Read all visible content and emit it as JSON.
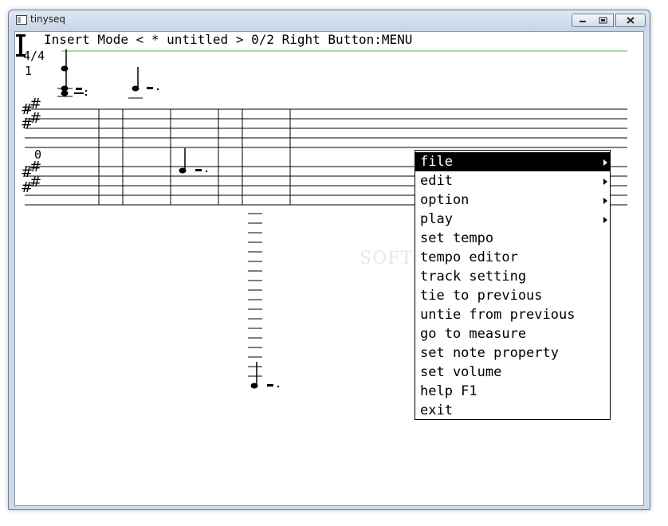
{
  "window": {
    "title": "tinyseq"
  },
  "status": {
    "text": "Insert Mode < * untitled > 0/2 Right Button:MENU"
  },
  "score": {
    "time_signature": "4/4",
    "measure_numbers": [
      "1",
      "0"
    ]
  },
  "menu": {
    "items": [
      {
        "label": "file",
        "submenu": true,
        "selected": true
      },
      {
        "label": "edit",
        "submenu": true,
        "selected": false
      },
      {
        "label": "option",
        "submenu": true,
        "selected": false
      },
      {
        "label": "play",
        "submenu": true,
        "selected": false
      },
      {
        "label": "set tempo",
        "submenu": false,
        "selected": false
      },
      {
        "label": "tempo editor",
        "submenu": false,
        "selected": false
      },
      {
        "label": "track setting",
        "submenu": false,
        "selected": false
      },
      {
        "label": "tie to previous",
        "submenu": false,
        "selected": false
      },
      {
        "label": "untie from previous",
        "submenu": false,
        "selected": false
      },
      {
        "label": "go to measure",
        "submenu": false,
        "selected": false
      },
      {
        "label": "set note property",
        "submenu": false,
        "selected": false
      },
      {
        "label": "set volume",
        "submenu": false,
        "selected": false
      },
      {
        "label": "help F1",
        "submenu": false,
        "selected": false
      },
      {
        "label": "exit",
        "submenu": false,
        "selected": false
      }
    ]
  },
  "watermark": "SOFTPEDIA",
  "colors": {
    "cursor_line": "#33cc33",
    "menu_selected_bg": "#000000",
    "menu_selected_fg": "#ffffff"
  }
}
